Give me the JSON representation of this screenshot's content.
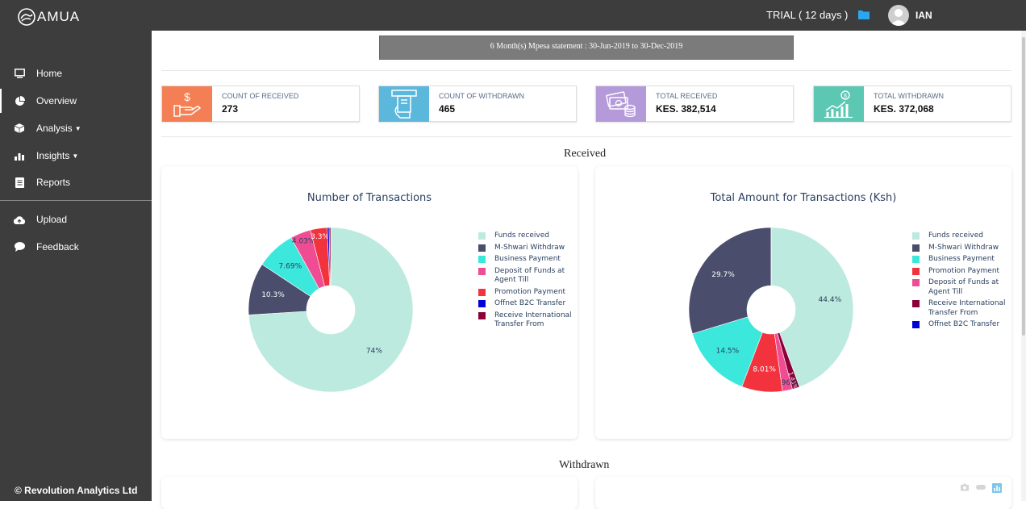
{
  "app": {
    "logo_text": "AMUA"
  },
  "topbar": {
    "trial": "TRIAL ( 12 days )",
    "user": "IAN"
  },
  "sidebar": {
    "items": [
      {
        "label": "Home",
        "icon": "monitor-icon"
      },
      {
        "label": "Overview",
        "icon": "pie-chart-icon"
      },
      {
        "label": "Analysis",
        "icon": "cube-icon"
      },
      {
        "label": "Insights",
        "icon": "bar-chart-icon"
      },
      {
        "label": "Reports",
        "icon": "document-icon"
      },
      {
        "label": "Upload",
        "icon": "cloud-upload-icon"
      },
      {
        "label": "Feedback",
        "icon": "speech-bubble-icon"
      }
    ],
    "copyright": "© Revolution Analytics Ltd"
  },
  "statement": "6 Month(s) Mpesa statement : 30-Jun-2019 to 30-Dec-2019",
  "cards": [
    {
      "label": "COUNT OF RECEIVED",
      "value": "273",
      "color": "#f47f55",
      "icon": "hand-money-icon"
    },
    {
      "label": "COUNT OF WITHDRAWN",
      "value": "465",
      "color": "#5bb8dc",
      "icon": "atm-icon"
    },
    {
      "label": "TOTAL RECEIVED",
      "value": "KES. 382,514",
      "color": "#b49ad8",
      "icon": "cash-coins-icon"
    },
    {
      "label": "TOTAL WITHDRAWN",
      "value": "KES. 372,068",
      "color": "#5cc7b2",
      "icon": "growth-chart-icon"
    }
  ],
  "sections": {
    "received": "Received",
    "withdrawn": "Withdrawn"
  },
  "chart_data": [
    {
      "type": "pie",
      "title": "Number of Transactions",
      "hole": true,
      "categories": [
        "Funds received",
        "M-Shwari Withdraw",
        "Business Payment",
        "Deposit of Funds at Agent Till",
        "Promotion Payment",
        "Offnet B2C Transfer",
        "Receive International Transfer From"
      ],
      "values": [
        74,
        10.3,
        7.69,
        4.03,
        3.3,
        0.37,
        0.31
      ],
      "labels": [
        "74%",
        "10.3%",
        "7.69%",
        "4.03%",
        "3.3%",
        "",
        ""
      ],
      "colors": [
        "#bdeadf",
        "#4a4d6c",
        "#3ce7dc",
        "#f04c93",
        "#f2333d",
        "#0000d8",
        "#8b0038"
      ],
      "legend": [
        "Funds received",
        "M-Shwari Withdraw",
        "Business Payment",
        "Deposit of Funds at Agent Till",
        "Promotion Payment",
        "Offnet B2C Transfer",
        "Receive International Transfer From"
      ]
    },
    {
      "type": "pie",
      "title": "Total Amount for Transactions (Ksh)",
      "hole": true,
      "categories": [
        "Funds received",
        "Receive International Transfer From",
        "Deposit of Funds at Agent Till",
        "Promotion Payment",
        "Business Payment",
        "M-Shwari Withdraw",
        "Offnet B2C Transfer"
      ],
      "values": [
        44.4,
        1.43,
        1.96,
        8.01,
        14.5,
        29.7,
        0.01
      ],
      "labels": [
        "44.4%",
        "1.43%",
        "1.96%",
        "8.01%",
        "14.5%",
        "29.7%",
        ""
      ],
      "colors": [
        "#bdeadf",
        "#8b0038",
        "#f04c93",
        "#f2333d",
        "#3ce7dc",
        "#4a4d6c",
        "#0000d8"
      ],
      "legend": [
        "Funds received",
        "M-Shwari Withdraw",
        "Business Payment",
        "Promotion Payment",
        "Deposit of Funds at Agent Till",
        "Receive International Transfer From",
        "Offnet B2C Transfer"
      ],
      "legend_colors": [
        "#bdeadf",
        "#4a4d6c",
        "#3ce7dc",
        "#f2333d",
        "#f04c93",
        "#8b0038",
        "#0000d8"
      ]
    }
  ]
}
